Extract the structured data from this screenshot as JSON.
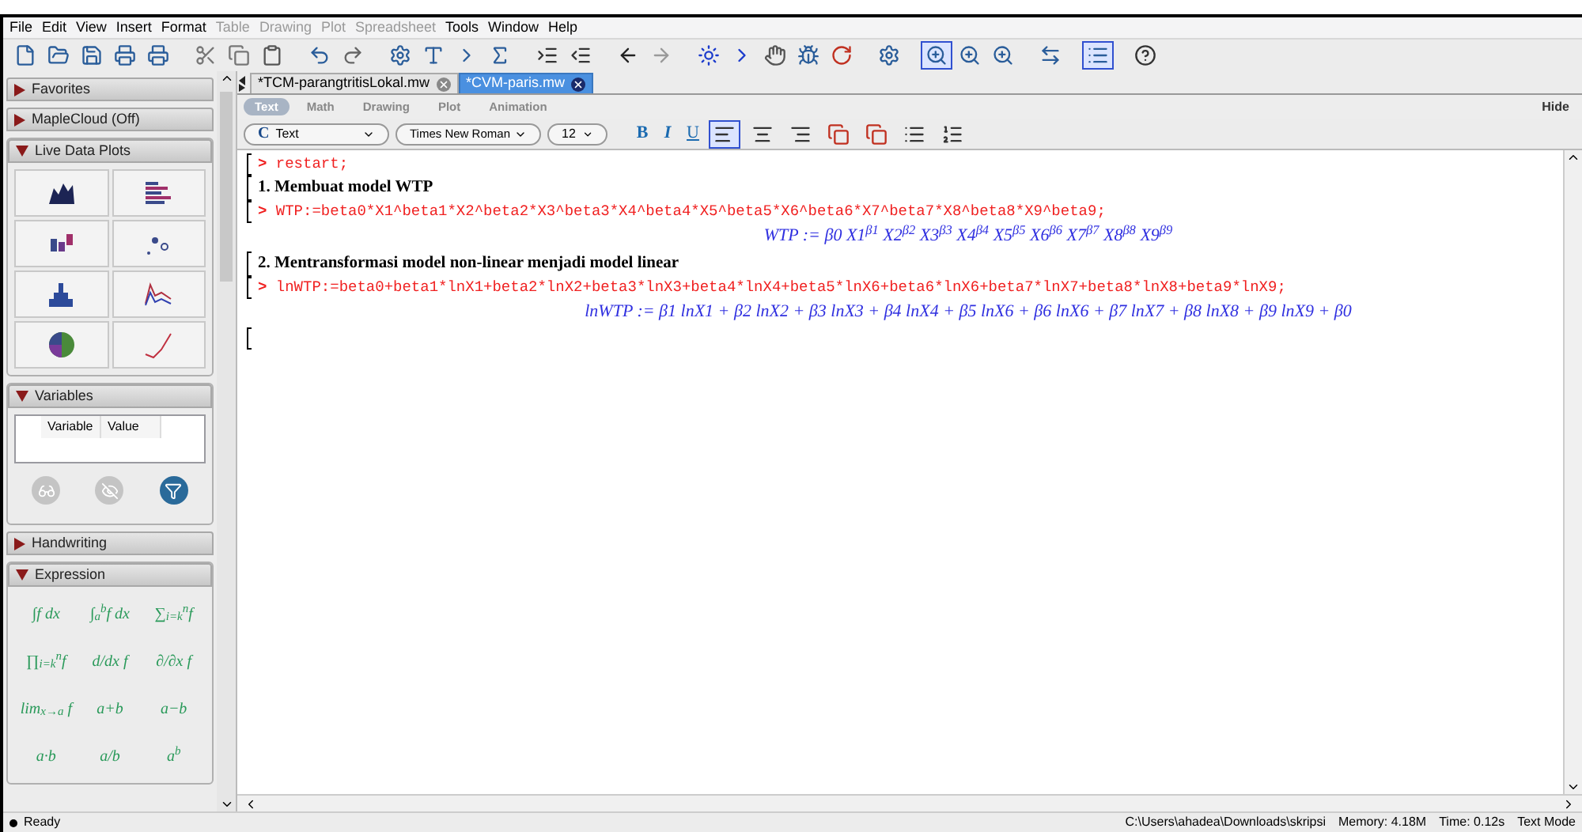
{
  "menu": [
    {
      "label": "File",
      "disabled": false
    },
    {
      "label": "Edit",
      "disabled": false
    },
    {
      "label": "View",
      "disabled": false
    },
    {
      "label": "Insert",
      "disabled": false
    },
    {
      "label": "Format",
      "disabled": false
    },
    {
      "label": "Table",
      "disabled": true
    },
    {
      "label": "Drawing",
      "disabled": true
    },
    {
      "label": "Plot",
      "disabled": true
    },
    {
      "label": "Spreadsheet",
      "disabled": true
    },
    {
      "label": "Tools",
      "disabled": false
    },
    {
      "label": "Window",
      "disabled": false
    },
    {
      "label": "Help",
      "disabled": false
    }
  ],
  "sidebar": {
    "palettes": [
      {
        "title": "Favorites",
        "expanded": false
      },
      {
        "title": "MapleCloud (Off)",
        "expanded": false
      },
      {
        "title": "Live Data Plots",
        "expanded": true,
        "kind": "plots"
      },
      {
        "title": "Variables",
        "expanded": true,
        "kind": "variables",
        "columns": [
          "Variable",
          "Value"
        ]
      },
      {
        "title": "Handwriting",
        "expanded": false
      },
      {
        "title": "Expression",
        "expanded": true,
        "kind": "expression",
        "items": [
          "∫f dx",
          "∫$_{a}$$^{b}$f dx",
          "∑$_{i=k}$$^{n}$f",
          "∏$_{i=k}$$^{n}$f",
          "d/dx f",
          "∂/∂x f",
          "lim$_{x→a}$ f",
          "a+b",
          "a−b",
          "a·b",
          "a/b",
          "a$^{b}$"
        ]
      }
    ]
  },
  "document_tabs": [
    {
      "label": "*TCM-parangtritisLokal.mw",
      "selected": false
    },
    {
      "label": "*CVM-paris.mw",
      "selected": true
    }
  ],
  "mode_tabs": [
    {
      "label": "Text",
      "selected": true
    },
    {
      "label": "Math",
      "selected": false
    },
    {
      "label": "Drawing",
      "selected": false
    },
    {
      "label": "Plot",
      "selected": false
    },
    {
      "label": "Animation",
      "selected": false
    }
  ],
  "hide_label": "Hide",
  "format_bar": {
    "style": "Text",
    "style_icon": "C",
    "font": "Times New Roman",
    "size": "12",
    "bold": "B",
    "italic": "I",
    "underline": "U"
  },
  "worksheet": [
    {
      "kind": "input",
      "prompt": ">",
      "text": "restart;"
    },
    {
      "kind": "heading",
      "text": "1.  Membuat model WTP"
    },
    {
      "kind": "input",
      "prompt": ">",
      "text": "WTP:=beta0*X1^beta1*X2^beta2*X3^beta3*X4^beta4*X5^beta5*X6^beta6*X7^beta7*X8^beta8*X9^beta9;"
    },
    {
      "kind": "output",
      "text": "WTP := β0 X1$^{β1}$ X2$^{β2}$ X3$^{β3}$ X4$^{β4}$ X5$^{β5}$ X6$^{β6}$ X7$^{β7}$ X8$^{β8}$ X9$^{β9}$"
    },
    {
      "kind": "heading",
      "text": "2.  Mentransformasi model non-linear menjadi model linear"
    },
    {
      "kind": "input",
      "prompt": ">",
      "text": "lnWTP:=beta0+beta1*lnX1+beta2*lnX2+beta3*lnX3+beta4*lnX4+beta5*lnX6+beta6*lnX6+beta7*lnX7+beta8*lnX8+beta9*lnX9;"
    },
    {
      "kind": "output",
      "text": "lnWTP := β1 lnX1 + β2 lnX2 + β3 lnX3 + β4 lnX4 + β5 lnX6 + β6 lnX6 + β7 lnX7 + β8 lnX8 + β9 lnX9 + β0"
    },
    {
      "kind": "empty"
    }
  ],
  "status_bar": {
    "status": "Ready",
    "path": "C:\\Users\\ahadea\\Downloads\\skripsi",
    "memory": "Memory: 4.18M",
    "time": "Time: 0.12s",
    "mode": "Text Mode"
  }
}
